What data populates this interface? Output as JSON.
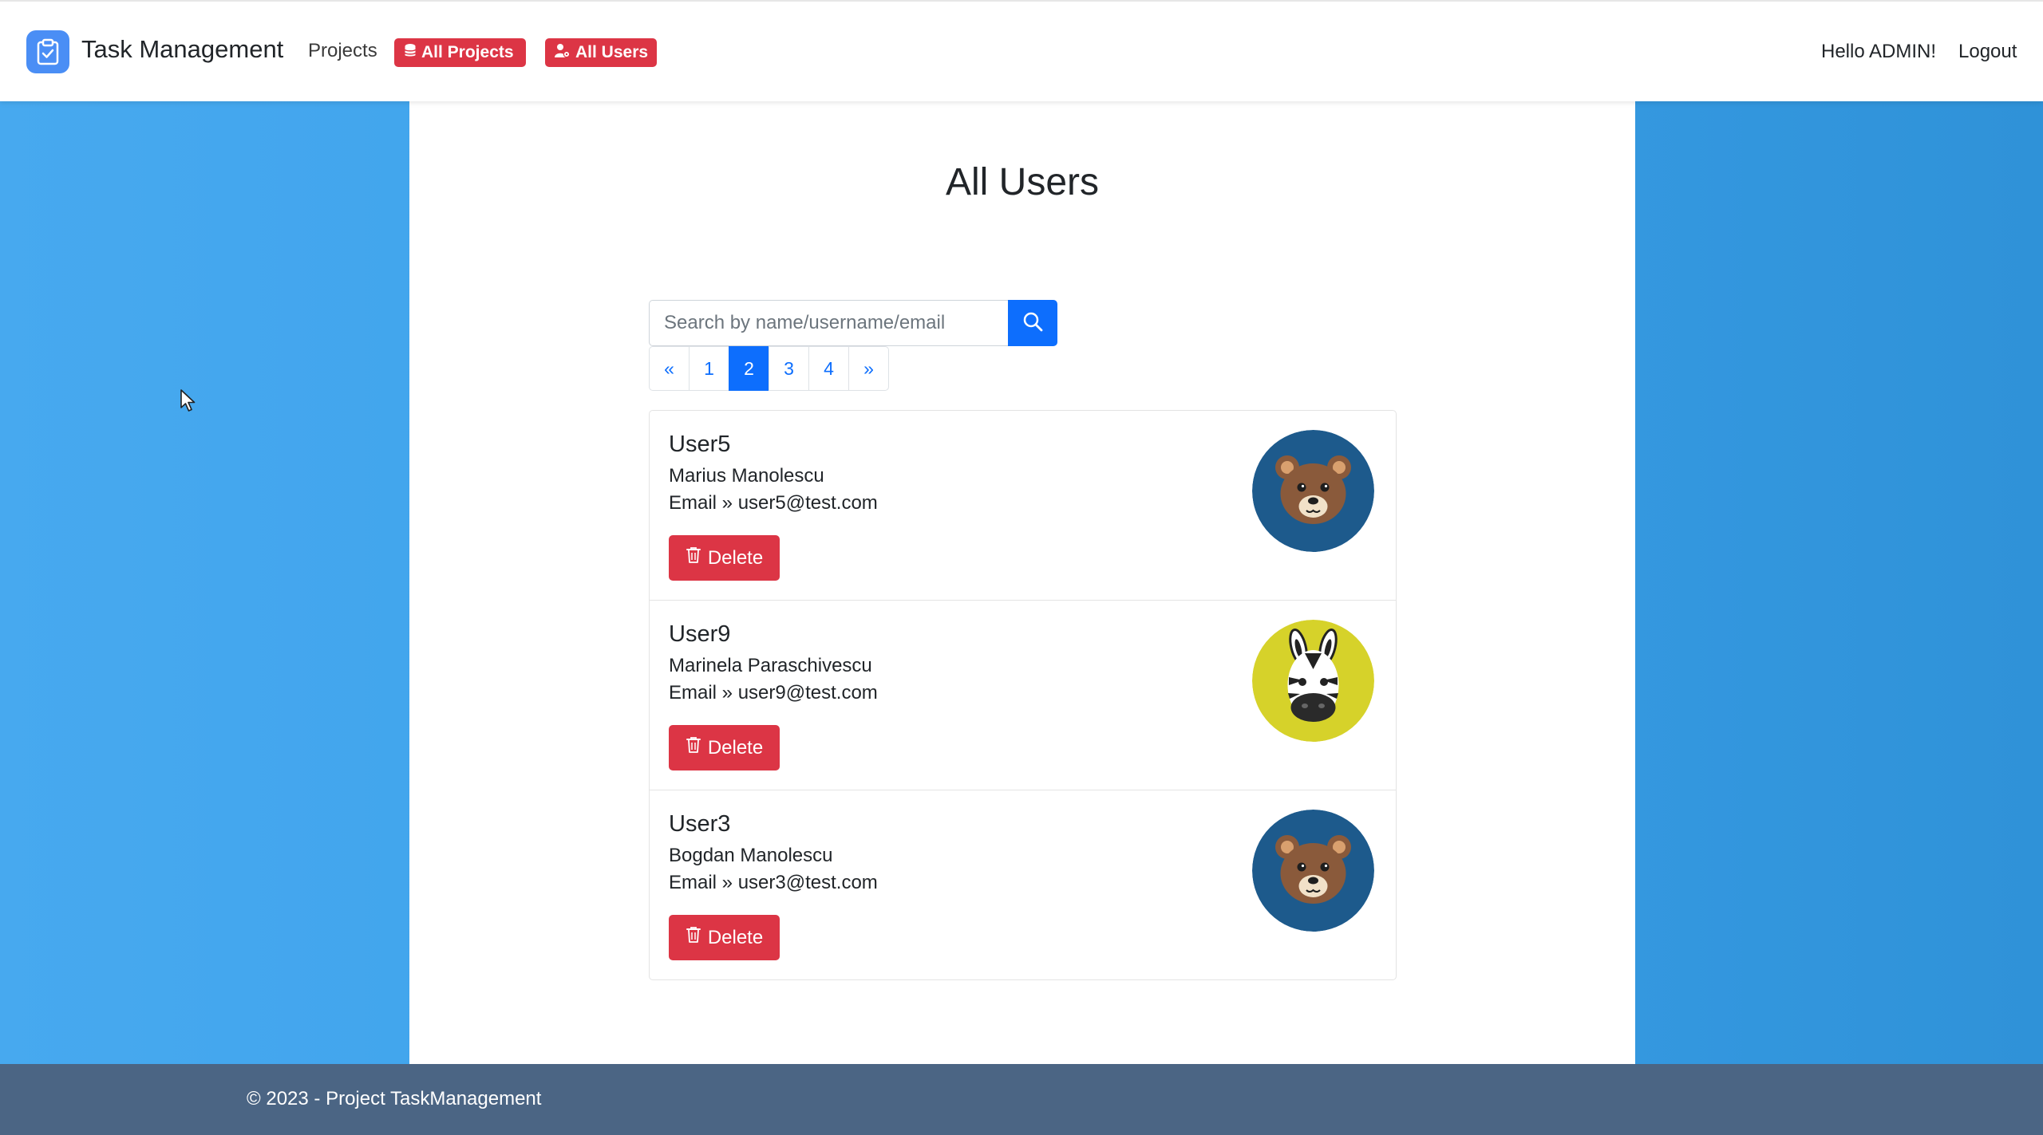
{
  "navbar": {
    "brand": "Task Management",
    "projects_link": "Projects",
    "all_projects_badge": "All Projects",
    "all_users_badge": "All Users",
    "greeting": "Hello ADMIN!",
    "logout": "Logout"
  },
  "main": {
    "title": "All Users",
    "search": {
      "placeholder": "Search by name/username/email",
      "value": ""
    },
    "pagination": {
      "prev": "«",
      "pages": [
        "1",
        "2",
        "3",
        "4"
      ],
      "active_page": "2",
      "next": "»"
    },
    "users": [
      {
        "username": "User5",
        "full_name": "Marius Manolescu",
        "email": "Email » user5@test.com",
        "delete_label": "Delete",
        "avatar": "bear-icon"
      },
      {
        "username": "User9",
        "full_name": "Marinela Paraschivescu",
        "email": "Email » user9@test.com",
        "delete_label": "Delete",
        "avatar": "zebra-icon"
      },
      {
        "username": "User3",
        "full_name": "Bogdan Manolescu",
        "email": "Email » user3@test.com",
        "delete_label": "Delete",
        "avatar": "bear-icon"
      }
    ]
  },
  "footer": {
    "text": "© 2023 - Project TaskManagement"
  },
  "colors": {
    "primary": "#0d6efd",
    "danger": "#dc3545",
    "footer": "#4b6584",
    "background": "#3ba0ea",
    "bear_avatar_bg": "#1d5a8c",
    "zebra_avatar_bg": "#d6d22a"
  }
}
